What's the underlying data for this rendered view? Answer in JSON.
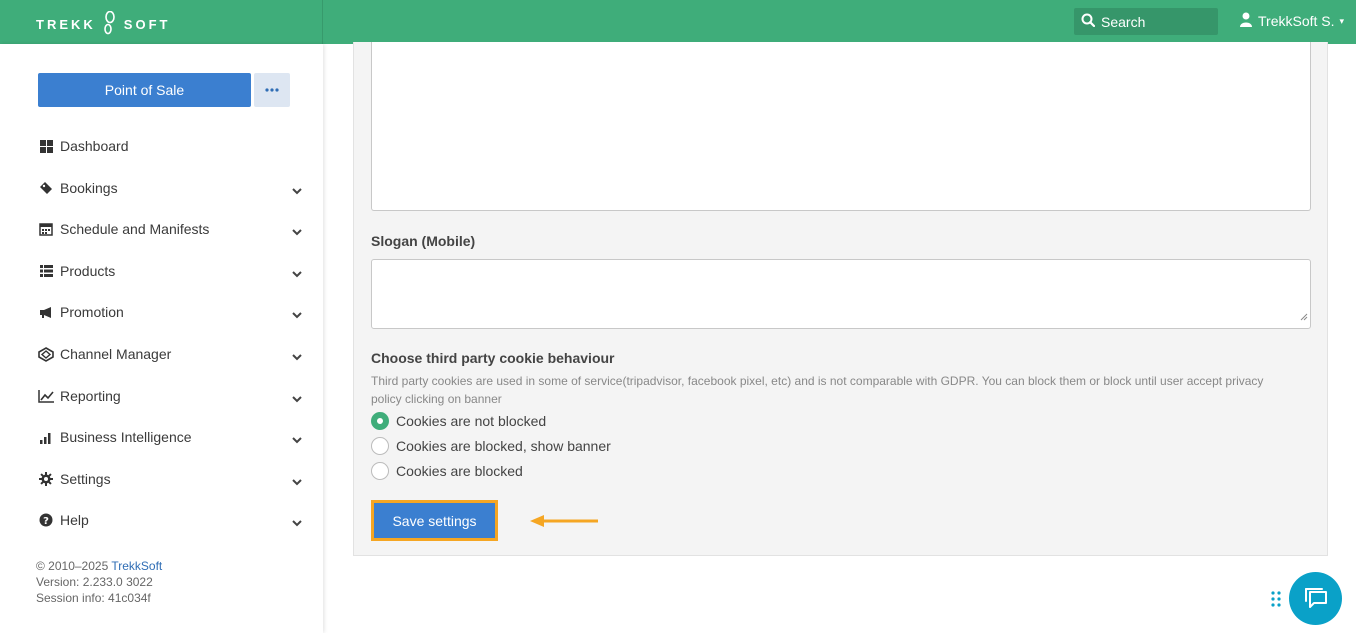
{
  "header": {
    "logo_left": "TREKK",
    "logo_right": "SOFT",
    "search_placeholder": "Search",
    "user_name": "TrekkSoft S."
  },
  "sidebar": {
    "pos_button": "Point of Sale",
    "items": [
      {
        "label": "Dashboard",
        "icon": "dashboard-icon",
        "has_chevron": false
      },
      {
        "label": "Bookings",
        "icon": "tag-icon",
        "has_chevron": true
      },
      {
        "label": "Schedule and Manifests",
        "icon": "calendar-icon",
        "has_chevron": true
      },
      {
        "label": "Products",
        "icon": "list-icon",
        "has_chevron": true
      },
      {
        "label": "Promotion",
        "icon": "megaphone-icon",
        "has_chevron": true
      },
      {
        "label": "Channel Manager",
        "icon": "network-icon",
        "has_chevron": true
      },
      {
        "label": "Reporting",
        "icon": "line-chart-icon",
        "has_chevron": true
      },
      {
        "label": "Business Intelligence",
        "icon": "bar-chart-icon",
        "has_chevron": true
      },
      {
        "label": "Settings",
        "icon": "gear-icon",
        "has_chevron": true
      },
      {
        "label": "Help",
        "icon": "question-icon",
        "has_chevron": true
      }
    ],
    "footer": {
      "copyright": "© 2010–2025 ",
      "brand": "TrekkSoft",
      "version": "Version: 2.233.0 3022",
      "session": "Session info: 41c034f"
    }
  },
  "form": {
    "slogan_label": "Slogan (Mobile)",
    "cookie_label": "Choose third party cookie behaviour",
    "cookie_help": "Third party cookies are used in some of service(tripadvisor, facebook pixel, etc) and is not comparable with GDPR. You can block them or block until user accept privacy policy clicking on banner",
    "cookie_options": [
      {
        "label": "Cookies are not blocked",
        "selected": true
      },
      {
        "label": "Cookies are blocked, show banner",
        "selected": false
      },
      {
        "label": "Cookies are blocked",
        "selected": false
      }
    ],
    "save_button": "Save settings"
  },
  "colors": {
    "brand_green": "#3fad7a",
    "primary_blue": "#3b7fd0",
    "highlight_orange": "#f5a623",
    "chat_teal": "#0aa1c8"
  }
}
